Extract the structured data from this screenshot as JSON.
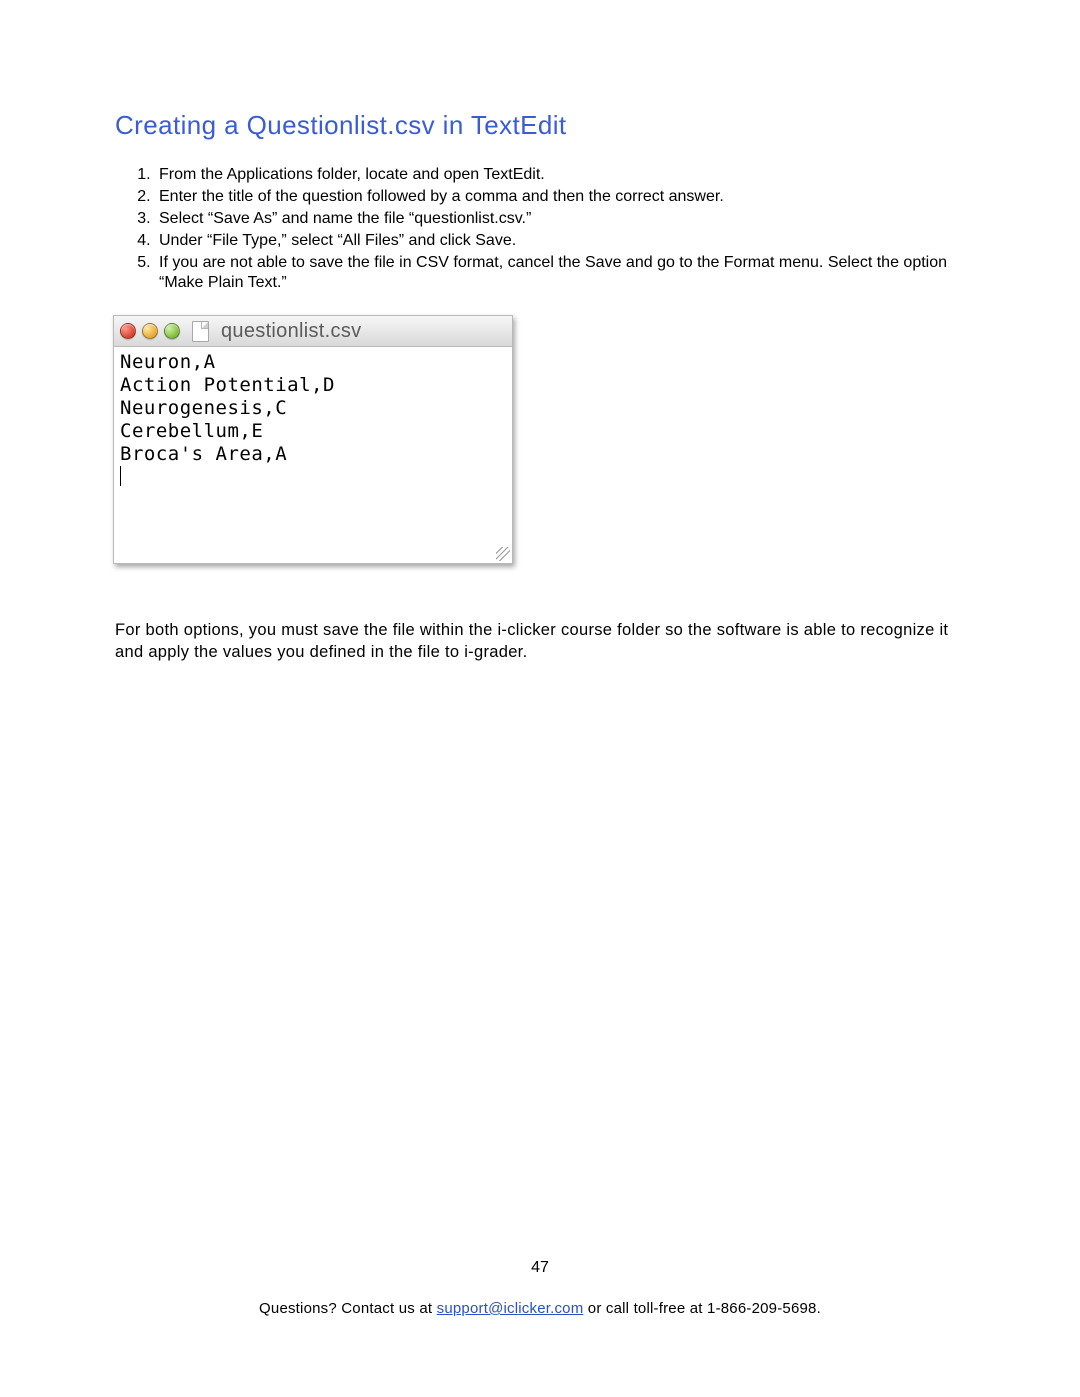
{
  "heading": "Creating a Questionlist.csv in TextEdit",
  "steps": [
    "From the Applications folder, locate and open TextEdit.",
    "Enter the title of the question followed by a comma and then the correct answer.",
    "Select “Save As” and name the file “questionlist.csv.”",
    "Under “File Type,” select “All Files” and click Save.",
    "If you are not able to save the file in CSV format, cancel the Save and go to the Format menu. Select the option “Make Plain Text.”"
  ],
  "textedit": {
    "title": "questionlist.csv",
    "lines": [
      "Neuron,A",
      "Action Potential,D",
      "Neurogenesis,C",
      "Cerebellum,E",
      "Broca's Area,A"
    ]
  },
  "note": "For both options, you must save the file within the i-clicker course folder so the software is able to recognize it and apply the values you defined in the file to i-grader.",
  "page_number": "47",
  "footer": {
    "prefix": "Questions? Contact us at ",
    "email": "support@iclicker.com",
    "middle": " or call toll-free at ",
    "phone": "1-866-209-5698",
    "suffix": "."
  }
}
